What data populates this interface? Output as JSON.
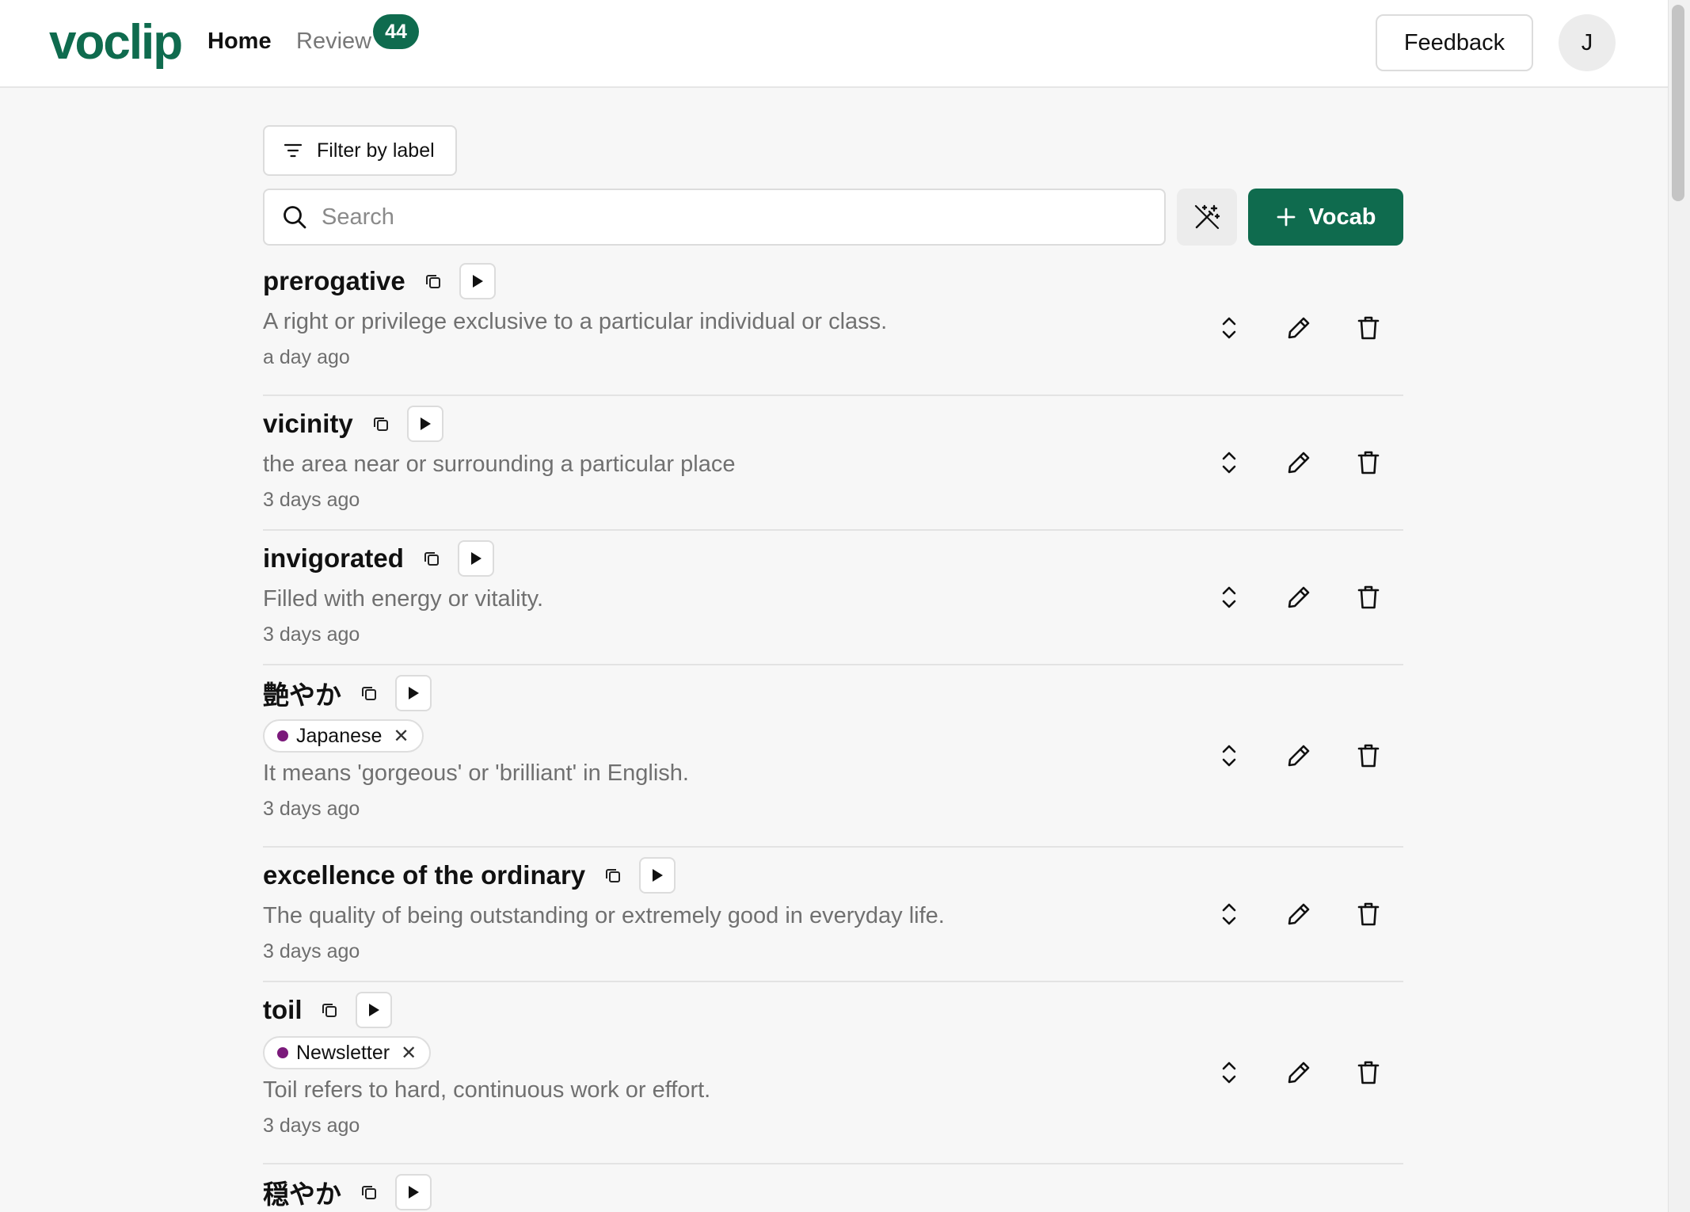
{
  "app": {
    "logo": "voclip"
  },
  "nav": {
    "home_label": "Home",
    "review_label": "Review",
    "review_count": "44"
  },
  "header": {
    "feedback_label": "Feedback",
    "avatar_initial": "J"
  },
  "toolbar": {
    "filter_label": "Filter by label",
    "search_placeholder": "Search",
    "search_value": "",
    "add_label": "Vocab"
  },
  "colors": {
    "brand": "#0f6b4e",
    "label_dot": "#7b1a7b"
  },
  "icons": {
    "filter": "filter-lines-icon",
    "search": "magnifier-icon",
    "magic": "magic-wand-icon",
    "add": "plus-icon",
    "copy": "copy-icon",
    "play": "play-triangle-icon",
    "expand": "chevron-up-down-icon",
    "edit": "pencil-icon",
    "delete": "trash-icon",
    "remove_label": "x-icon"
  },
  "vocab_items": [
    {
      "term": "prerogative",
      "definition": "A right or privilege exclusive to a particular individual or class.",
      "time": "a day ago",
      "label": ""
    },
    {
      "term": "vicinity",
      "definition": "the area near or surrounding a particular place",
      "time": "3 days ago",
      "label": ""
    },
    {
      "term": "invigorated",
      "definition": "Filled with energy or vitality.",
      "time": "3 days ago",
      "label": ""
    },
    {
      "term": "艶やか",
      "definition": "It means 'gorgeous' or 'brilliant' in English.",
      "time": "3 days ago",
      "label": "Japanese"
    },
    {
      "term": "excellence of the ordinary",
      "definition": "The quality of being outstanding or extremely good in everyday life.",
      "time": "3 days ago",
      "label": ""
    },
    {
      "term": "toil",
      "definition": "Toil refers to hard, continuous work or effort.",
      "time": "3 days ago",
      "label": "Newsletter"
    },
    {
      "term": "穏やか",
      "definition": "",
      "time": "",
      "label": ""
    }
  ]
}
